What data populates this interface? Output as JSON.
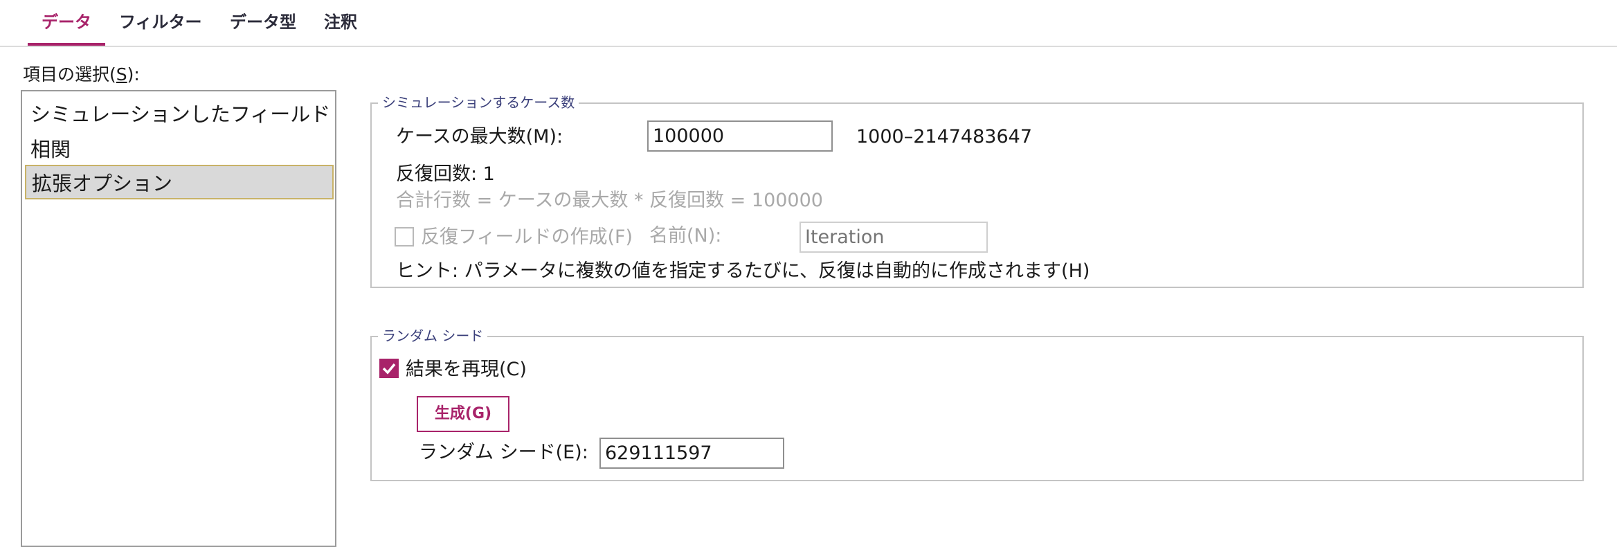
{
  "tabs": [
    {
      "label": "データ",
      "active": true
    },
    {
      "label": "フィルター",
      "active": false
    },
    {
      "label": "データ型",
      "active": false
    },
    {
      "label": "注釈",
      "active": false
    }
  ],
  "item_select": {
    "label_prefix": "項目の選択(",
    "label_key": "S",
    "label_suffix": "):",
    "items": [
      "シミュレーションしたフィールド",
      "相関",
      "拡張オプション"
    ],
    "selected_index": 2
  },
  "cases_group": {
    "legend": "シミュレーションするケース数",
    "max_cases_label": "ケースの最大数(M):",
    "max_cases_value": "100000",
    "range_text": "1000–2147483647",
    "iterations_text": "反復回数: 1",
    "total_rows_text": "合計行数 = ケースの最大数 * 反復回数 = 100000",
    "create_iteration_label": "反復フィールドの作成(F)",
    "create_iteration_checked": false,
    "name_label": "名前(N):",
    "name_placeholder": "Iteration",
    "hint_text": "ヒント: パラメータに複数の値を指定するたびに、反復は自動的に作成されます(H)"
  },
  "seed_group": {
    "legend": "ランダム シード",
    "reproduce_label": "結果を再現(C)",
    "reproduce_checked": true,
    "generate_button": "生成(G)",
    "seed_label": "ランダム シード(E):",
    "seed_value": "629111597"
  },
  "colors": {
    "accent": "#a8236a",
    "legend_text": "#3a3f7a",
    "selected_item_bg": "#d9d9d9",
    "selected_item_border": "#c8b267"
  }
}
